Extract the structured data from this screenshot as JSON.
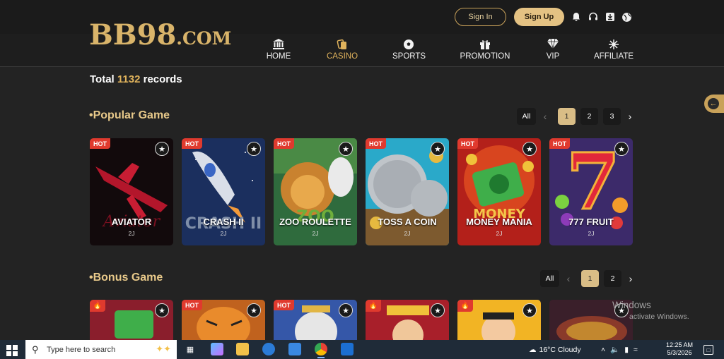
{
  "header": {
    "logo_main": "BB98",
    "logo_suffix": ".COM",
    "signin_label": "Sign In",
    "signup_label": "Sign Up",
    "icons": [
      "bell-icon",
      "headset-icon",
      "download-icon",
      "globe-icon"
    ]
  },
  "nav": {
    "items": [
      {
        "label": "HOME",
        "icon": "bank-icon"
      },
      {
        "label": "CASINO",
        "icon": "cards-icon",
        "active": true
      },
      {
        "label": "SPORTS",
        "icon": "soccer-ball-icon"
      },
      {
        "label": "PROMOTION",
        "icon": "gift-icon"
      },
      {
        "label": "VIP",
        "icon": "diamond-icon"
      },
      {
        "label": "AFFILIATE",
        "icon": "network-icon"
      }
    ]
  },
  "records": {
    "prefix": "Total",
    "count": "1132",
    "suffix": "records"
  },
  "popular": {
    "title": "•Popular Game",
    "pager": {
      "all": "All",
      "pages": [
        "1",
        "2",
        "3"
      ],
      "current": "1"
    },
    "games": [
      {
        "name": "AVIATOR",
        "provider": "2J",
        "badge": "HOT"
      },
      {
        "name": "CRASH II",
        "provider": "2J",
        "badge": "HOT"
      },
      {
        "name": "ZOO ROULETTE",
        "provider": "2J",
        "badge": "HOT"
      },
      {
        "name": "TOSS A COIN",
        "provider": "2J",
        "badge": "HOT"
      },
      {
        "name": "MONEY MANIA",
        "provider": "2J",
        "badge": "HOT"
      },
      {
        "name": "777 FRUIT",
        "provider": "2J",
        "badge": "HOT"
      }
    ]
  },
  "bonus": {
    "title": "•Bonus Game",
    "pager": {
      "all": "All",
      "pages": [
        "1",
        "2"
      ],
      "current": "1"
    },
    "games": [
      {
        "badge": "fire"
      },
      {
        "badge": "HOT"
      },
      {
        "badge": "HOT"
      },
      {
        "badge": "fire"
      },
      {
        "badge": "fire"
      },
      {
        "badge": "none"
      }
    ]
  },
  "watermark": {
    "line1": "Windows",
    "line2": "activate Windows."
  },
  "taskbar": {
    "search_placeholder": "Type here to search",
    "weather": "16°C  Cloudy",
    "time": "12:25 AM",
    "date": "5/3/2026"
  },
  "colors": {
    "accent": "#e0b35c",
    "hot": "#e03a2e",
    "background": "#232323"
  }
}
